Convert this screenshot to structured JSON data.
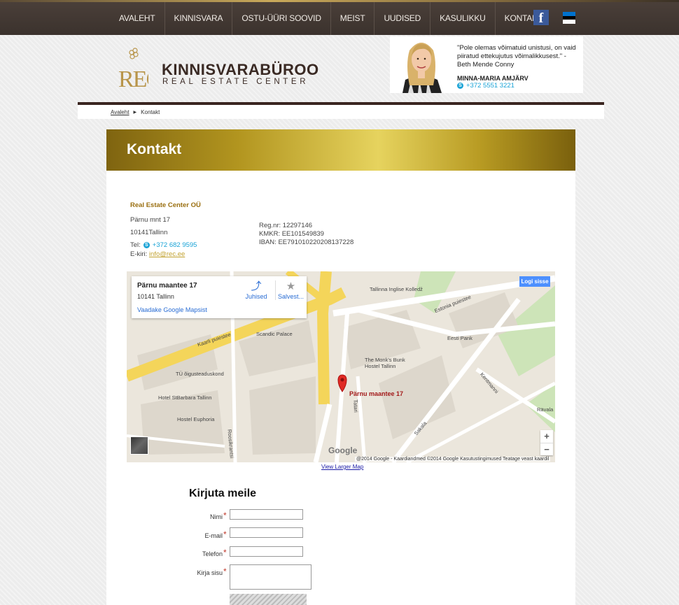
{
  "nav": {
    "items": [
      "AVALEHT",
      "KINNISVARA",
      "OSTU-ÜÜRI SOOVID",
      "MEIST",
      "UUDISED",
      "KASULIKKU",
      "KONTAKT"
    ],
    "facebook_icon": "facebook-icon",
    "language_icon": "estonian-flag-icon"
  },
  "header": {
    "logo_mark": "REC",
    "logo_title": "KINNISVARABÜROO",
    "logo_subtitle": "REAL ESTATE CENTER",
    "agent": {
      "quote": "\"Pole olemas võimatuid unistusi, on vaid piiratud ettekujutus võimalikkusest.\" - Beth Mende Conny",
      "name": "MINNA-MARIA AMJÄRV",
      "phone": "+372 5551 3221"
    }
  },
  "breadcrumb": {
    "home": "Avaleht",
    "current": "Kontakt"
  },
  "page": {
    "title": "Kontakt",
    "company": "Real Estate Center OÜ",
    "address_street": "Pärnu mnt 17",
    "address_city": "10141Tallinn",
    "tel_label": "Tel:",
    "tel": "+372 682 9595",
    "email_label": "E-kiri:",
    "email": "info@rec.ee",
    "reg_nr": "Reg.nr: 12297146",
    "kmkr": "KMKR: EE101549839",
    "iban": "IBAN: EE791010220208137228"
  },
  "map": {
    "card_title": "Pärnu maantee 17",
    "card_subtitle": "10141 Tallinn",
    "card_link": "Vaadake Google Mapsist",
    "directions": "Juhised",
    "save": "Salvest...",
    "login": "Logi sisse",
    "pin_label": "Pärnu maantee 17",
    "logo": "Google",
    "attribution": "@2014 Google - Kaardiandmed ©2014 Google   Kasutustingimused   Teatage veast kaardil",
    "labels": {
      "kaarli": "Kaarli puiestee",
      "scandic": "Scandic Palace",
      "inglise": "Tallinna Inglise Kolledž",
      "estonia": "Estonia puiestee",
      "eesti_pank": "Eesti Pank",
      "monks": "The Monk's Bunk Hostel Tallinn",
      "oigus": "TÜ õigusteaduskond",
      "stbarbara": "Hotel StBarbara Tallinn",
      "euphoria": "Hostel Euphoria",
      "roosikrantsi": "Roosikrantsi",
      "tatari": "Tatari",
      "sakala": "Sakala",
      "kentmanni": "Kentmanni",
      "ravala": "Rävala"
    },
    "view_larger": "View Larger Map"
  },
  "form": {
    "title": "Kirjuta meile",
    "name_label": "Nimi",
    "email_label": "E-mail",
    "phone_label": "Telefon",
    "message_label": "Kirja sisu",
    "required_mark": "*"
  }
}
